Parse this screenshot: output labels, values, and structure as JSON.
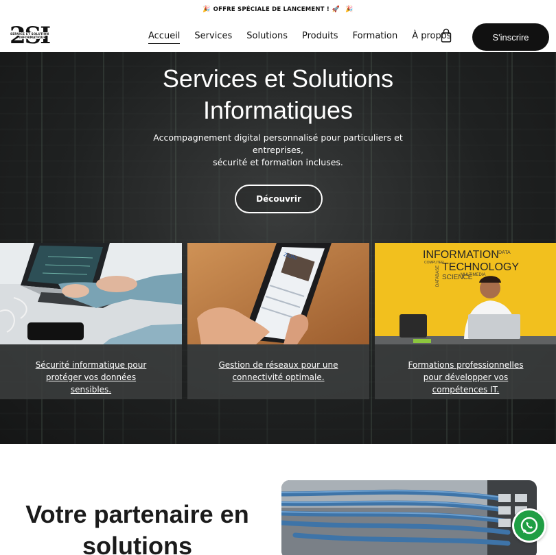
{
  "announce": {
    "text": "OFFRE SPÉCIALE DE LANCEMENT !",
    "emoji_left": "🎉",
    "emoji_rocket": "🚀",
    "emoji_right": "🎉"
  },
  "logo": {
    "mark": "2SI",
    "tagline_1": "SERVICE ET SOLUTION",
    "tagline_2": "INFORMATIQUE"
  },
  "nav": {
    "items": [
      "Accueil",
      "Services",
      "Solutions",
      "Produits",
      "Formation",
      "À propos"
    ],
    "active": "Accueil"
  },
  "header": {
    "cart_icon": "shopping-bag-icon",
    "signup_label": "S'inscrire"
  },
  "hero": {
    "title_line1": "Services et Solutions",
    "title_line2": "Informatiques",
    "subtitle_line1": "Accompagnement digital personnalisé pour particuliers et entreprises,",
    "subtitle_line2": "sécurité et formation incluses.",
    "cta_label": "Découvrir"
  },
  "cards": [
    {
      "caption": "Sécurité informatique pour protéger vos données sensibles."
    },
    {
      "caption": "Gestion de réseaux pour une connectivité optimale."
    },
    {
      "caption": "Formations professionnelles pour développer vos compétences IT."
    }
  ],
  "card_images": {
    "card2_screen_text": "ZIONI",
    "card3_wall_1": "INFORMATION",
    "card3_wall_2": "TECHNOLOGY",
    "card3_wall_3": "SCIENCE",
    "card3_wall_4": "DATA",
    "card3_wall_5": "MULTIMEDIA",
    "card3_wall_6": "COMPUTER",
    "card3_wall_7": "DATABASE"
  },
  "partner": {
    "heading_line1": "Votre partenaire en",
    "heading_line2": "solutions"
  },
  "whatsapp": {
    "icon": "whatsapp-icon"
  },
  "colors": {
    "accent": "#111111",
    "whatsapp": "#1f9e44",
    "card_caption_bg": "#3c3e3e",
    "yellow_wall": "#f2c01e"
  }
}
